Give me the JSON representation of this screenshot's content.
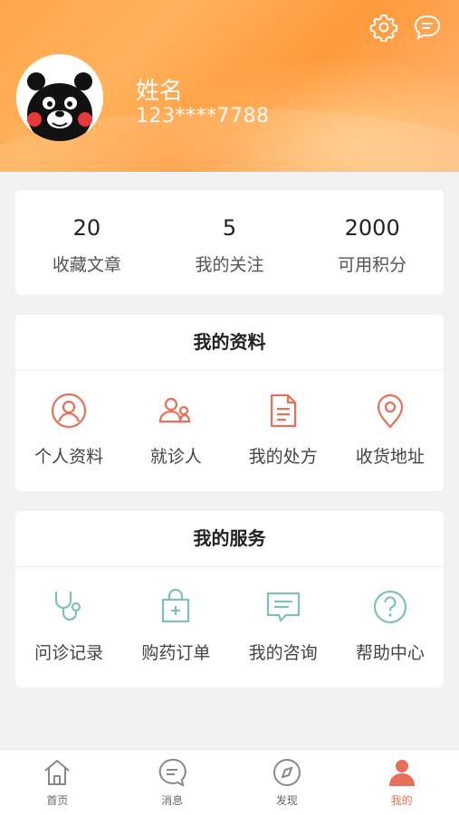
{
  "colors": {
    "accent": "#e86f59",
    "service": "#7fc1b5",
    "header_start": "#ffa64a",
    "header_end": "#ffb676"
  },
  "header": {
    "icons": [
      "gear-icon",
      "message-bubble-icon"
    ]
  },
  "user": {
    "name": "姓名",
    "phone": "123****7788"
  },
  "stats": [
    {
      "value": "20",
      "label": "收藏文章"
    },
    {
      "value": "5",
      "label": "我的关注"
    },
    {
      "value": "2000",
      "label": "可用积分"
    }
  ],
  "profile": {
    "title": "我的资料",
    "items": [
      {
        "label": "个人资料",
        "icon": "user-circle-icon"
      },
      {
        "label": "就诊人",
        "icon": "patients-icon"
      },
      {
        "label": "我的处方",
        "icon": "prescription-document-icon"
      },
      {
        "label": "收货地址",
        "icon": "location-pin-icon"
      }
    ]
  },
  "services": {
    "title": "我的服务",
    "items": [
      {
        "label": "问诊记录",
        "icon": "stethoscope-icon"
      },
      {
        "label": "购药订单",
        "icon": "medicine-bag-icon"
      },
      {
        "label": "我的咨询",
        "icon": "chat-bubble-icon"
      },
      {
        "label": "帮助中心",
        "icon": "help-question-icon"
      }
    ]
  },
  "tabbar": {
    "active": "我的",
    "items": [
      {
        "label": "首页",
        "icon": "home-icon"
      },
      {
        "label": "消息",
        "icon": "message-icon"
      },
      {
        "label": "发现",
        "icon": "compass-icon"
      },
      {
        "label": "我的",
        "icon": "person-icon"
      }
    ]
  }
}
